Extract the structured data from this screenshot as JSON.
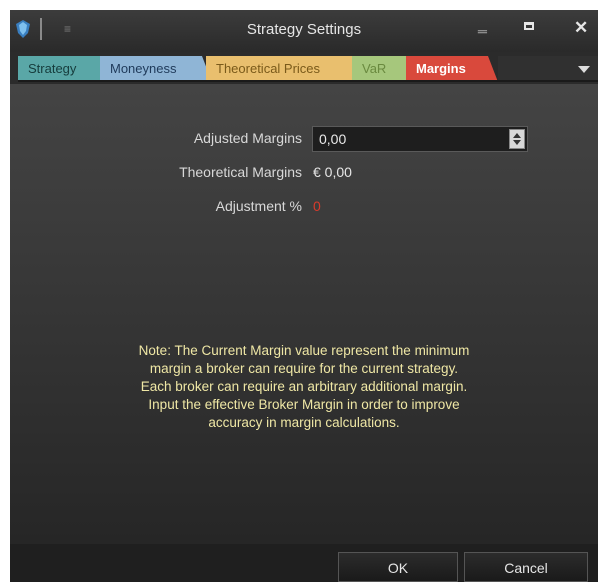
{
  "window": {
    "title": "Strategy Settings"
  },
  "tabs": [
    {
      "label": "Strategy"
    },
    {
      "label": "Moneyness"
    },
    {
      "label": "Theoretical Prices"
    },
    {
      "label": "VaR"
    },
    {
      "label": "Margins",
      "active": true
    }
  ],
  "margins": {
    "adjusted_label": "Adjusted Margins",
    "adjusted_value": "0,00",
    "theoretical_label": "Theoretical Margins",
    "theoretical_value": "€ 0,00",
    "adjustment_label": "Adjustment %",
    "adjustment_value": "0"
  },
  "note": [
    "Note: The Current Margin value represent the minimum",
    "margin a broker can require for the current strategy.",
    "Each broker can require an arbitrary additional margin.",
    "Input the effective Broker Margin in order to improve",
    "accuracy in margin calculations."
  ],
  "buttons": {
    "ok": "OK",
    "cancel": "Cancel"
  },
  "colors": {
    "tab_strategy": "#5aa7a7",
    "tab_moneyness": "#8fb5d6",
    "tab_theoretical": "#e9bf6e",
    "tab_var": "#a6c77c",
    "tab_margins": "#d9493c",
    "note_text": "#efe7a5",
    "adjustment_value": "#d93a2b"
  },
  "icons": {
    "app": "shield-gem-icon",
    "menu": "menu-icon",
    "minimize": "minimize-icon",
    "maximize": "maximize-icon",
    "close": "close-icon",
    "dropdown": "chevron-down-icon"
  }
}
